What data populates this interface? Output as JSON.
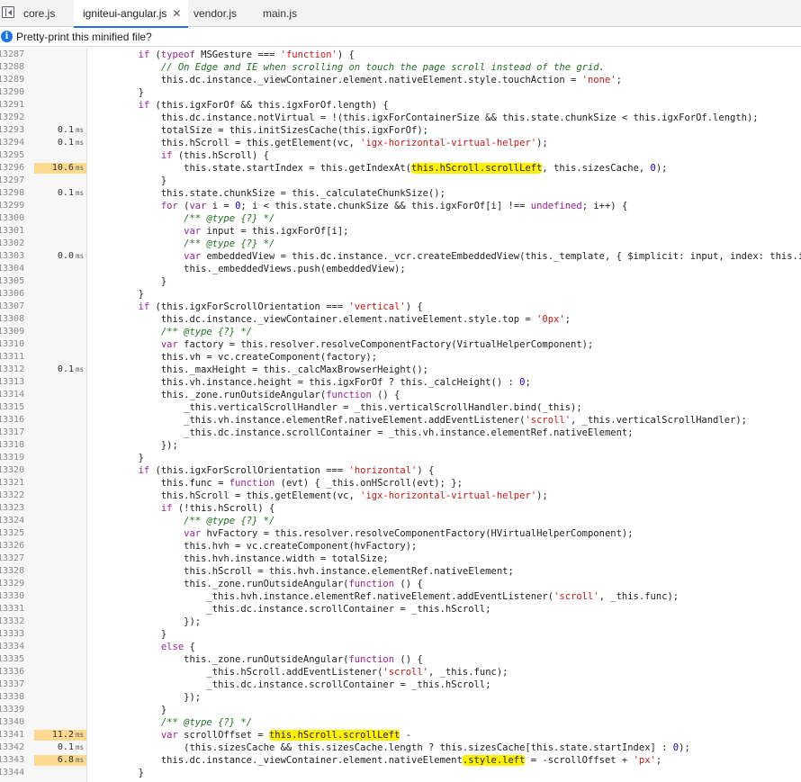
{
  "tabs": [
    {
      "label": "core.js",
      "active": false
    },
    {
      "label": "igniteui-angular.js",
      "active": true,
      "close": "✕"
    },
    {
      "label": "vendor.js",
      "active": false
    },
    {
      "label": "main.js",
      "active": false
    }
  ],
  "infobar": {
    "text": "Pretty-print this minified file?"
  },
  "highlight_color": "#fff200",
  "hot_timing_color": "#fcd98f",
  "lines": [
    {
      "no": "13287",
      "t": "",
      "c": [
        [
          "        ",
          ""
        ],
        [
          "if",
          "kw"
        ],
        [
          " (",
          ""
        ],
        [
          "typeof",
          "kw"
        ],
        [
          " MSGesture === ",
          ""
        ],
        [
          "'function'",
          "str"
        ],
        [
          ") {",
          ""
        ]
      ]
    },
    {
      "no": "13288",
      "t": "",
      "c": [
        [
          "            ",
          ""
        ],
        [
          "// On Edge and IE when scrolling on touch the page scroll instead of the grid.",
          "cm"
        ]
      ]
    },
    {
      "no": "13289",
      "t": "",
      "c": [
        [
          "            this.dc.instance._viewContainer.element.nativeElement.style.touchAction = ",
          ""
        ],
        [
          "'none'",
          "str"
        ],
        [
          ";",
          ""
        ]
      ]
    },
    {
      "no": "13290",
      "t": "",
      "c": [
        [
          "        }",
          ""
        ]
      ]
    },
    {
      "no": "13291",
      "t": "",
      "c": [
        [
          "        ",
          ""
        ],
        [
          "if",
          "kw"
        ],
        [
          " (this.igxForOf && this.igxForOf.length) {",
          ""
        ]
      ]
    },
    {
      "no": "13292",
      "t": "",
      "c": [
        [
          "            this.dc.instance.notVirtual = !(this.igxForContainerSize && this.state.chunkSize < this.igxForOf.length);",
          ""
        ]
      ]
    },
    {
      "no": "13293",
      "t": "0.1",
      "c": [
        [
          "            totalSize = this.initSizesCache(this.igxForOf);",
          ""
        ]
      ]
    },
    {
      "no": "13294",
      "t": "0.1",
      "c": [
        [
          "            this.hScroll = this.getElement(vc, ",
          ""
        ],
        [
          "'igx-horizontal-virtual-helper'",
          "str"
        ],
        [
          ");",
          ""
        ]
      ]
    },
    {
      "no": "13295",
      "t": "",
      "c": [
        [
          "            ",
          ""
        ],
        [
          "if",
          "kw"
        ],
        [
          " (this.hScroll) {",
          ""
        ]
      ]
    },
    {
      "no": "13296",
      "t": "10.6",
      "hot": true,
      "c": [
        [
          "                this.state.startIndex = this.getIndexAt(",
          ""
        ],
        [
          "this.hScroll.scrollLeft",
          "hl"
        ],
        [
          ", this.sizesCache, ",
          ""
        ],
        [
          "0",
          "num"
        ],
        [
          ");",
          ""
        ]
      ]
    },
    {
      "no": "13297",
      "t": "",
      "c": [
        [
          "            }",
          ""
        ]
      ]
    },
    {
      "no": "13298",
      "t": "0.1",
      "c": [
        [
          "            this.state.chunkSize = this._calculateChunkSize();",
          ""
        ]
      ]
    },
    {
      "no": "13299",
      "t": "",
      "c": [
        [
          "            ",
          ""
        ],
        [
          "for",
          "kw"
        ],
        [
          " (",
          ""
        ],
        [
          "var",
          "kw"
        ],
        [
          " i = ",
          ""
        ],
        [
          "0",
          "num"
        ],
        [
          "; i < this.state.chunkSize && this.igxForOf[i] !== ",
          ""
        ],
        [
          "undefined",
          "kw"
        ],
        [
          "; i++) {",
          ""
        ]
      ]
    },
    {
      "no": "13300",
      "t": "",
      "c": [
        [
          "                ",
          ""
        ],
        [
          "/** @type {?} */",
          "cm"
        ]
      ]
    },
    {
      "no": "13301",
      "t": "",
      "c": [
        [
          "                ",
          ""
        ],
        [
          "var",
          "kw"
        ],
        [
          " input = this.igxForOf[i];",
          ""
        ]
      ]
    },
    {
      "no": "13302",
      "t": "",
      "c": [
        [
          "                ",
          ""
        ],
        [
          "/** @type {?} */",
          "cm"
        ]
      ]
    },
    {
      "no": "13303",
      "t": "0.0",
      "c": [
        [
          "                ",
          ""
        ],
        [
          "var",
          "kw"
        ],
        [
          " embeddedView = this.dc.instance._vcr.createEmbeddedView(this._template, { $implicit: input, index: this.igxForOf.indexOf(input) });",
          ""
        ]
      ]
    },
    {
      "no": "13304",
      "t": "",
      "c": [
        [
          "                this._embeddedViews.push(embeddedView);",
          ""
        ]
      ]
    },
    {
      "no": "13305",
      "t": "",
      "c": [
        [
          "            }",
          ""
        ]
      ]
    },
    {
      "no": "13306",
      "t": "",
      "c": [
        [
          "        }",
          ""
        ]
      ]
    },
    {
      "no": "13307",
      "t": "",
      "c": [
        [
          "        ",
          ""
        ],
        [
          "if",
          "kw"
        ],
        [
          " (this.igxForScrollOrientation === ",
          ""
        ],
        [
          "'vertical'",
          "str"
        ],
        [
          ") {",
          ""
        ]
      ]
    },
    {
      "no": "13308",
      "t": "",
      "c": [
        [
          "            this.dc.instance._viewContainer.element.nativeElement.style.top = ",
          ""
        ],
        [
          "'0px'",
          "str"
        ],
        [
          ";",
          ""
        ]
      ]
    },
    {
      "no": "13309",
      "t": "",
      "c": [
        [
          "            ",
          ""
        ],
        [
          "/** @type {?} */",
          "cm"
        ]
      ]
    },
    {
      "no": "13310",
      "t": "",
      "c": [
        [
          "            ",
          ""
        ],
        [
          "var",
          "kw"
        ],
        [
          " factory = this.resolver.resolveComponentFactory(VirtualHelperComponent);",
          ""
        ]
      ]
    },
    {
      "no": "13311",
      "t": "",
      "c": [
        [
          "            this.vh = vc.createComponent(factory);",
          ""
        ]
      ]
    },
    {
      "no": "13312",
      "t": "0.1",
      "c": [
        [
          "            this._maxHeight = this._calcMaxBrowserHeight();",
          ""
        ]
      ]
    },
    {
      "no": "13313",
      "t": "",
      "c": [
        [
          "            this.vh.instance.height = this.igxForOf ? this._calcHeight() : ",
          ""
        ],
        [
          "0",
          "num"
        ],
        [
          ";",
          ""
        ]
      ]
    },
    {
      "no": "13314",
      "t": "",
      "c": [
        [
          "            this._zone.runOutsideAngular(",
          ""
        ],
        [
          "function",
          "kw"
        ],
        [
          " () {",
          ""
        ]
      ]
    },
    {
      "no": "13315",
      "t": "",
      "c": [
        [
          "                _this.verticalScrollHandler = _this.verticalScrollHandler.bind(_this);",
          ""
        ]
      ]
    },
    {
      "no": "13316",
      "t": "",
      "c": [
        [
          "                _this.vh.instance.elementRef.nativeElement.addEventListener(",
          ""
        ],
        [
          "'scroll'",
          "str"
        ],
        [
          ", _this.verticalScrollHandler);",
          ""
        ]
      ]
    },
    {
      "no": "13317",
      "t": "",
      "c": [
        [
          "                _this.dc.instance.scrollContainer = _this.vh.instance.elementRef.nativeElement;",
          ""
        ]
      ]
    },
    {
      "no": "13318",
      "t": "",
      "c": [
        [
          "            });",
          ""
        ]
      ]
    },
    {
      "no": "13319",
      "t": "",
      "c": [
        [
          "        }",
          ""
        ]
      ]
    },
    {
      "no": "13320",
      "t": "",
      "c": [
        [
          "        ",
          ""
        ],
        [
          "if",
          "kw"
        ],
        [
          " (this.igxForScrollOrientation === ",
          ""
        ],
        [
          "'horizontal'",
          "str"
        ],
        [
          ") {",
          ""
        ]
      ]
    },
    {
      "no": "13321",
      "t": "",
      "c": [
        [
          "            this.func = ",
          ""
        ],
        [
          "function",
          "kw"
        ],
        [
          " (evt) { _this.onHScroll(evt); };",
          ""
        ]
      ]
    },
    {
      "no": "13322",
      "t": "",
      "c": [
        [
          "            this.hScroll = this.getElement(vc, ",
          ""
        ],
        [
          "'igx-horizontal-virtual-helper'",
          "str"
        ],
        [
          ");",
          ""
        ]
      ]
    },
    {
      "no": "13323",
      "t": "",
      "c": [
        [
          "            ",
          ""
        ],
        [
          "if",
          "kw"
        ],
        [
          " (!this.hScroll) {",
          ""
        ]
      ]
    },
    {
      "no": "13324",
      "t": "",
      "c": [
        [
          "                ",
          ""
        ],
        [
          "/** @type {?} */",
          "cm"
        ]
      ]
    },
    {
      "no": "13325",
      "t": "",
      "c": [
        [
          "                ",
          ""
        ],
        [
          "var",
          "kw"
        ],
        [
          " hvFactory = this.resolver.resolveComponentFactory(HVirtualHelperComponent);",
          ""
        ]
      ]
    },
    {
      "no": "13326",
      "t": "",
      "c": [
        [
          "                this.hvh = vc.createComponent(hvFactory);",
          ""
        ]
      ]
    },
    {
      "no": "13327",
      "t": "",
      "c": [
        [
          "                this.hvh.instance.width = totalSize;",
          ""
        ]
      ]
    },
    {
      "no": "13328",
      "t": "",
      "c": [
        [
          "                this.hScroll = this.hvh.instance.elementRef.nativeElement;",
          ""
        ]
      ]
    },
    {
      "no": "13329",
      "t": "",
      "c": [
        [
          "                this._zone.runOutsideAngular(",
          ""
        ],
        [
          "function",
          "kw"
        ],
        [
          " () {",
          ""
        ]
      ]
    },
    {
      "no": "13330",
      "t": "",
      "c": [
        [
          "                    _this.hvh.instance.elementRef.nativeElement.addEventListener(",
          ""
        ],
        [
          "'scroll'",
          "str"
        ],
        [
          ", _this.func);",
          ""
        ]
      ]
    },
    {
      "no": "13331",
      "t": "",
      "c": [
        [
          "                    _this.dc.instance.scrollContainer = _this.hScroll;",
          ""
        ]
      ]
    },
    {
      "no": "13332",
      "t": "",
      "c": [
        [
          "                });",
          ""
        ]
      ]
    },
    {
      "no": "13333",
      "t": "",
      "c": [
        [
          "            }",
          ""
        ]
      ]
    },
    {
      "no": "13334",
      "t": "",
      "c": [
        [
          "            ",
          ""
        ],
        [
          "else",
          "kw"
        ],
        [
          " {",
          ""
        ]
      ]
    },
    {
      "no": "13335",
      "t": "",
      "c": [
        [
          "                this._zone.runOutsideAngular(",
          ""
        ],
        [
          "function",
          "kw"
        ],
        [
          " () {",
          ""
        ]
      ]
    },
    {
      "no": "13336",
      "t": "",
      "c": [
        [
          "                    _this.hScroll.addEventListener(",
          ""
        ],
        [
          "'scroll'",
          "str"
        ],
        [
          ", _this.func);",
          ""
        ]
      ]
    },
    {
      "no": "13337",
      "t": "",
      "c": [
        [
          "                    _this.dc.instance.scrollContainer = _this.hScroll;",
          ""
        ]
      ]
    },
    {
      "no": "13338",
      "t": "",
      "c": [
        [
          "                });",
          ""
        ]
      ]
    },
    {
      "no": "13339",
      "t": "",
      "c": [
        [
          "            }",
          ""
        ]
      ]
    },
    {
      "no": "13340",
      "t": "",
      "c": [
        [
          "            ",
          ""
        ],
        [
          "/** @type {?} */",
          "cm"
        ]
      ]
    },
    {
      "no": "13341",
      "t": "11.2",
      "hot": true,
      "c": [
        [
          "            ",
          ""
        ],
        [
          "var",
          "kw"
        ],
        [
          " scrollOffset = ",
          ""
        ],
        [
          "this.hScroll.scrollLeft",
          "hl"
        ],
        [
          " -",
          ""
        ]
      ]
    },
    {
      "no": "13342",
      "t": "0.1",
      "c": [
        [
          "                (this.sizesCache && this.sizesCache.length ? this.sizesCache[this.state.startIndex] : ",
          ""
        ],
        [
          "0",
          "num"
        ],
        [
          ");",
          ""
        ]
      ]
    },
    {
      "no": "13343",
      "t": "6.8",
      "hot": true,
      "c": [
        [
          "            this.dc.instance._viewContainer.element.nativeElement",
          ""
        ],
        [
          ".style.left",
          "hl"
        ],
        [
          " = -scrollOffset + ",
          ""
        ],
        [
          "'px'",
          "str"
        ],
        [
          ";",
          ""
        ]
      ]
    },
    {
      "no": "13344",
      "t": "",
      "c": [
        [
          "        }",
          ""
        ]
      ]
    }
  ]
}
